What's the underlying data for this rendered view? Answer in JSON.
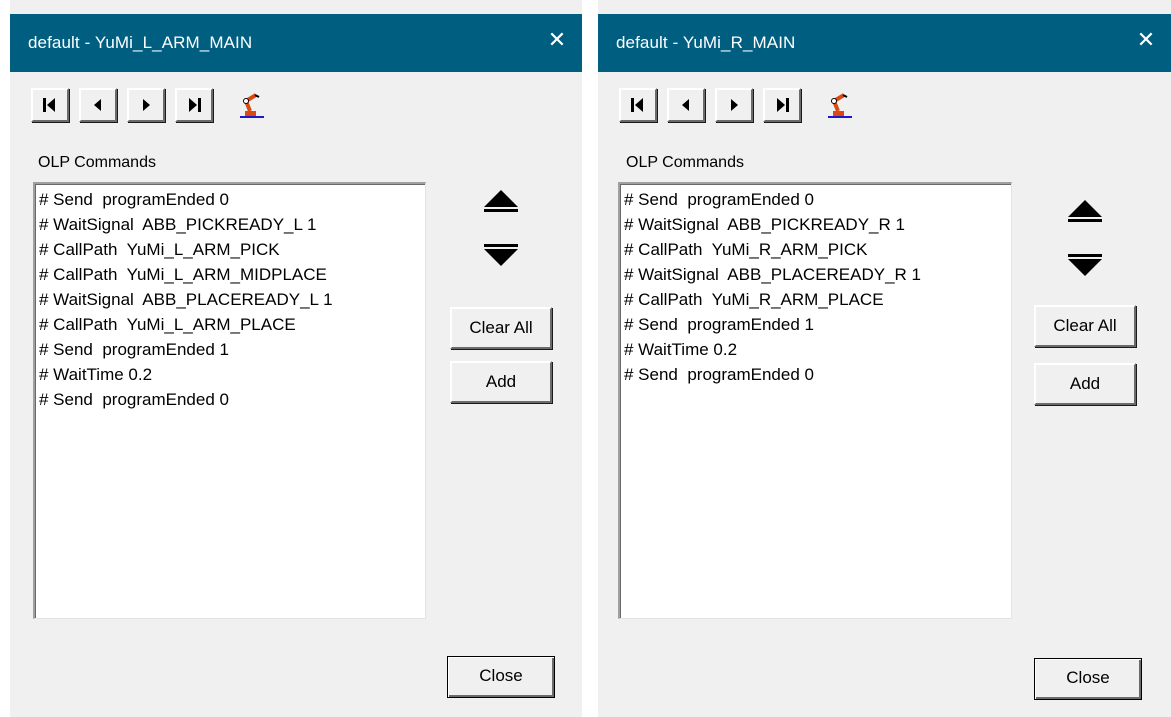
{
  "dialogs": [
    {
      "title": "default - YuMi_L_ARM_MAIN",
      "section_label": "OLP Commands",
      "commands": [
        "# Send  programEnded 0",
        "# WaitSignal  ABB_PICKREADY_L 1",
        "# CallPath  YuMi_L_ARM_PICK",
        "# CallPath  YuMi_L_ARM_MIDPLACE",
        "# WaitSignal  ABB_PLACEREADY_L 1",
        "# CallPath  YuMi_L_ARM_PLACE",
        "# Send  programEnded 1",
        "# WaitTime 0.2",
        "# Send  programEnded 0"
      ],
      "clear_all_label": "Clear All",
      "add_label": "Add",
      "close_label": "Close"
    },
    {
      "title": "default - YuMi_R_MAIN",
      "section_label": "OLP Commands",
      "commands": [
        "# Send  programEnded 0",
        "# WaitSignal  ABB_PICKREADY_R 1",
        "# CallPath  YuMi_R_ARM_PICK",
        "# WaitSignal  ABB_PLACEREADY_R 1",
        "# CallPath  YuMi_R_ARM_PLACE",
        "# Send  programEnded 1",
        "# WaitTime 0.2",
        "# Send  programEnded 0"
      ],
      "clear_all_label": "Clear All",
      "add_label": "Add",
      "close_label": "Close"
    }
  ],
  "window_close_glyph": "✕",
  "icons": {
    "nav": [
      "first-icon",
      "previous-icon",
      "next-icon",
      "last-icon"
    ],
    "robot": "robot-arm-icon",
    "move_up": "arrow-up-icon",
    "move_down": "arrow-down-icon"
  },
  "colors": {
    "titlebar": "#005e80",
    "dialog_bg": "#f0f0f0",
    "robot_icon": "#d94a12"
  }
}
